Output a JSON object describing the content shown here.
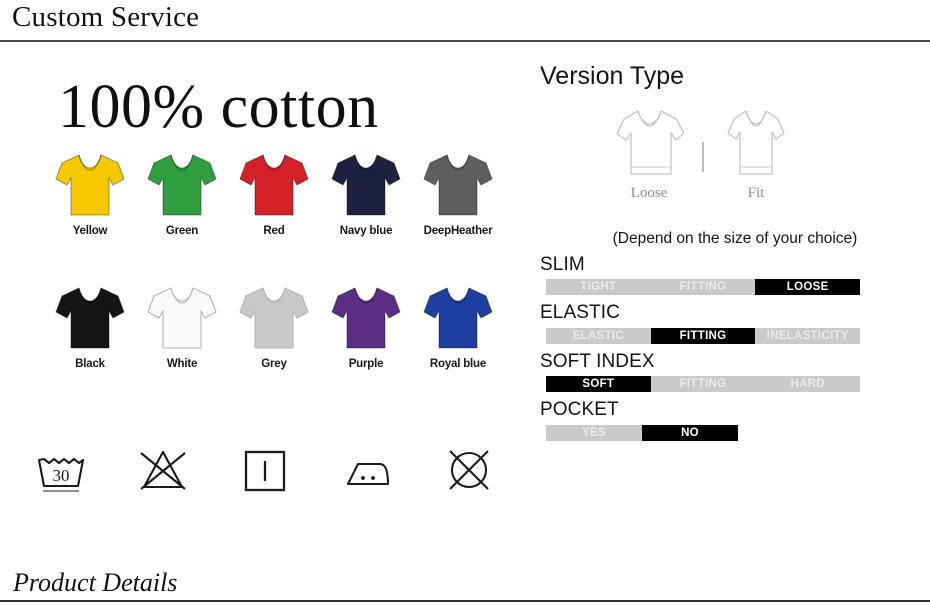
{
  "header": {
    "title": "Custom Service"
  },
  "footer": {
    "title": "Product Details"
  },
  "left": {
    "material_title": "100% cotton",
    "colors": [
      {
        "name": "Yellow",
        "hex": "#F5C800"
      },
      {
        "name": "Green",
        "hex": "#2E9E3E"
      },
      {
        "name": "Red",
        "hex": "#D42128"
      },
      {
        "name": "Navy blue",
        "hex": "#1C2240"
      },
      {
        "name": "DeepHeather",
        "hex": "#5E5E5E"
      },
      {
        "name": "Black",
        "hex": "#141414"
      },
      {
        "name": "White",
        "hex": "#F9F9F9"
      },
      {
        "name": "Grey",
        "hex": "#C9C9C9"
      },
      {
        "name": "Purple",
        "hex": "#5C2D85"
      },
      {
        "name": "Royal blue",
        "hex": "#1E3FA0"
      }
    ],
    "care_symbols": [
      {
        "name": "wash-30-icon",
        "temperature": "30"
      },
      {
        "name": "do-not-bleach-icon",
        "temperature": ""
      },
      {
        "name": "tumble-dry-icon",
        "temperature": ""
      },
      {
        "name": "iron-two-dots-icon",
        "temperature": ""
      },
      {
        "name": "do-not-dry-clean-icon",
        "temperature": ""
      }
    ]
  },
  "right": {
    "version_title": "Version Type",
    "versions": [
      {
        "label": "Loose"
      },
      {
        "label": "Fit"
      }
    ],
    "version_note": "(Depend on the size of your choice)",
    "attributes": [
      {
        "label": "SLIM",
        "segments": [
          {
            "text": "TIGHT",
            "selected": false
          },
          {
            "text": "FITTING",
            "selected": false
          },
          {
            "text": "LOOSE",
            "selected": true
          }
        ]
      },
      {
        "label": "ELASTIC",
        "segments": [
          {
            "text": "ELASTIC",
            "selected": false
          },
          {
            "text": "FITTING",
            "selected": true
          },
          {
            "text": "INELASTICITY",
            "selected": false
          }
        ]
      },
      {
        "label": "SOFT INDEX",
        "segments": [
          {
            "text": "SOFT",
            "selected": true
          },
          {
            "text": "FITTING",
            "selected": false
          },
          {
            "text": "HARD",
            "selected": false
          }
        ]
      },
      {
        "label": "POCKET",
        "segments": [
          {
            "text": "YES",
            "selected": false
          },
          {
            "text": "NO",
            "selected": true
          }
        ]
      }
    ]
  },
  "colors": {
    "selected_bar": "#000000",
    "unselected_bar": "#CACACA",
    "rule": "#4B4B4B"
  }
}
